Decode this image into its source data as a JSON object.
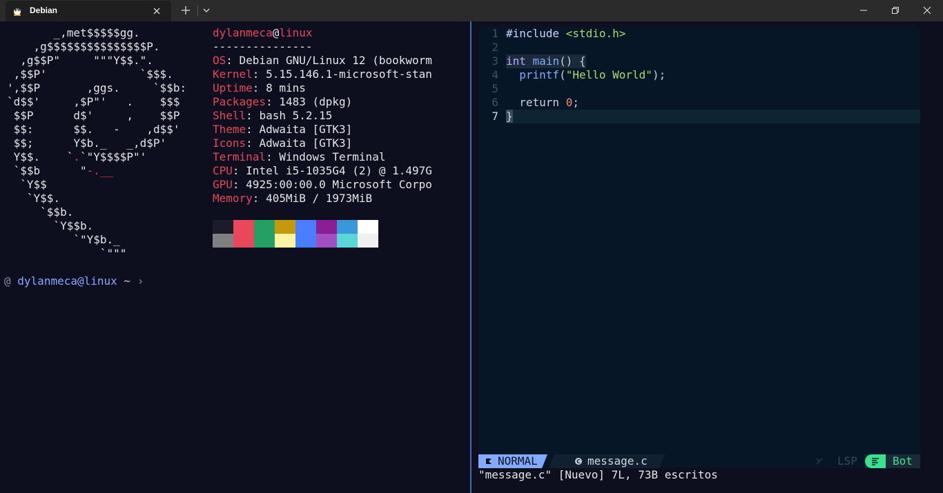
{
  "window": {
    "tab_title": "Debian",
    "tab_icon": "linux-penguin-icon",
    "controls": [
      "minimize-icon",
      "maximize-icon",
      "close-icon"
    ]
  },
  "left": {
    "logo_lines": [
      "       _,met$$$$$gg.",
      "    ,g$$$$$$$$$$$$$$$P.",
      "  ,g$$P\"     \"\"\"Y$$.\".",
      " ,$$P'              `$$$.",
      "',$$P       ,ggs.     `$$b:",
      "`d$$'     ,$P\"'   .    $$$",
      " $$P      d$'     ,    $$P",
      " $$:      $$.   -    ,d$$'",
      " $$;      Y$b._   _,d$P'",
      " Y$$.    `.`\"Y$$$$P\"'",
      " `$$b      \"-.__",
      "  `Y$$",
      "   `Y$$.",
      "     `$$b.",
      "       `Y$$b.",
      "          `\"Y$b._",
      "              `\"\"\""
    ],
    "user": "dylanmeca",
    "at": "@",
    "host": "linux",
    "separator": "---------------",
    "info": [
      {
        "key": "OS",
        "value": ": Debian GNU/Linux 12 (bookworm"
      },
      {
        "key": "Kernel",
        "value": ": 5.15.146.1-microsoft-stan"
      },
      {
        "key": "Uptime",
        "value": ": 8 mins"
      },
      {
        "key": "Packages",
        "value": ": 1483 (dpkg)"
      },
      {
        "key": "Shell",
        "value": ": bash 5.2.15"
      },
      {
        "key": "Theme",
        "value": ": Adwaita [GTK3]"
      },
      {
        "key": "Icons",
        "value": ": Adwaita [GTK3]"
      },
      {
        "key": "Terminal",
        "value": ": Windows Terminal"
      },
      {
        "key": "CPU",
        "value": ": Intel i5-1035G4 (2) @ 1.497G"
      },
      {
        "key": "GPU",
        "value": ": 4925:00:00.0 Microsoft Corpo"
      },
      {
        "key": "Memory",
        "value": ": 405MiB / 1973MiB"
      }
    ],
    "palette_top": [
      "#1b1b2a",
      "#e8485a",
      "#25a065",
      "#c49a0c",
      "#4a7dff",
      "#8a1f95",
      "#3b96da",
      "#ffffff"
    ],
    "palette_bottom": [
      "#808080",
      "#e8485a",
      "#25a065",
      "#fcf3a3",
      "#4a7dff",
      "#a04ec0",
      "#59d6d6",
      "#f0f0f0"
    ],
    "prompt": {
      "at": "@",
      "user_host": "dylanmeca@linux",
      "cwd": "~",
      "arrow": "›"
    }
  },
  "editor": {
    "line_numbers": [
      "1",
      "2",
      "3",
      "4",
      "5",
      "6",
      "7"
    ],
    "current_line": "7",
    "code": {
      "l1_include": "#include",
      "l1_header": "<stdio.h>",
      "l3_type": "int",
      "l3_fn": "main",
      "l3_rest": "() {",
      "l4_fn": "printf",
      "l4_open": "(",
      "l4_str": "\"Hello World\"",
      "l4_close": ");",
      "l6_kw": "return",
      "l6_num": "0",
      "l6_semi": ";",
      "l7": "}"
    },
    "status": {
      "mode": "NORMAL",
      "mode_color": "#82aaff",
      "file": "message.c",
      "lsp": "LSP",
      "position": "Bot",
      "position_color": "#3ae28e"
    },
    "message": "\"message.c\" [Nuevo] 7L, 73B escritos"
  }
}
